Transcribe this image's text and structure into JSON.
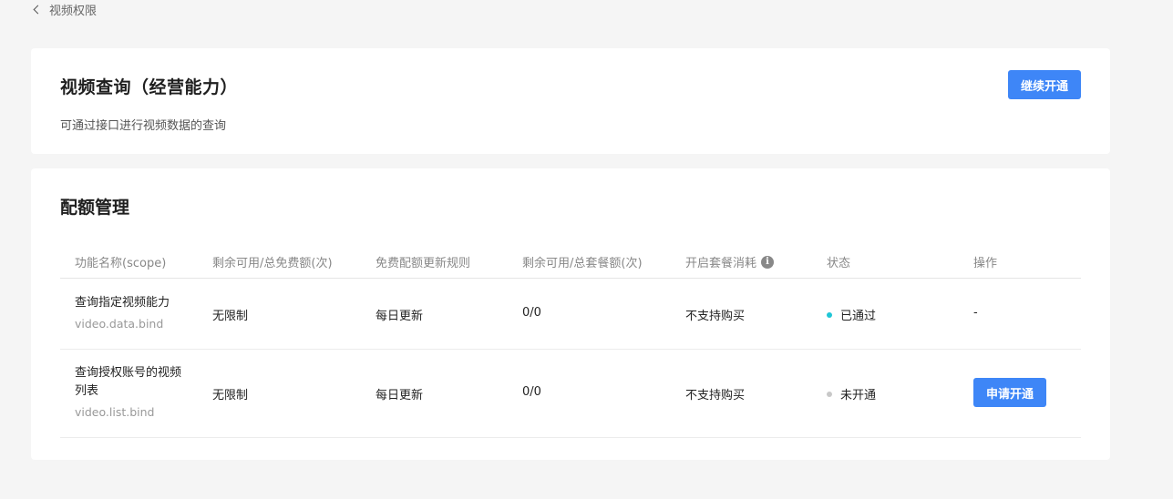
{
  "breadcrumb": {
    "label": "视频权限"
  },
  "service": {
    "title": "视频查询（经营能力）",
    "description": "可通过接口进行视频数据的查询",
    "continue_label": "继续开通"
  },
  "quota": {
    "title": "配额管理",
    "columns": [
      "功能名称(scope)",
      "剩余可用/总免费额(次)",
      "免费配额更新规则",
      "剩余可用/总套餐额(次)",
      "开启套餐消耗",
      "状态",
      "操作"
    ],
    "rows": [
      {
        "name": "查询指定视频能力",
        "scope": "video.data.bind",
        "free_quota": "无限制",
        "rule": "每日更新",
        "package_quota": "0/0",
        "package_consume": "不支持购买",
        "status": "已通过",
        "status_color": "#1fc6d6",
        "action": "-"
      },
      {
        "name": "查询授权账号的视频列表",
        "scope": "video.list.bind",
        "free_quota": "无限制",
        "rule": "每日更新",
        "package_quota": "0/0",
        "package_consume": "不支持购买",
        "status": "未开通",
        "status_color": "#c8c8c8",
        "action": "申请开通"
      }
    ]
  },
  "colors": {
    "accent": "#3e86f7",
    "background": "#f5f5f5"
  },
  "icons": {
    "back": "chevron-left-icon",
    "info": "info-circle-icon"
  }
}
